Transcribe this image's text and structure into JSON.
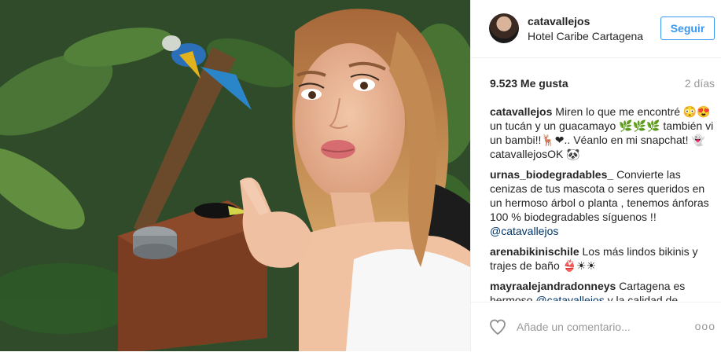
{
  "post": {
    "username": "catavallejos",
    "location": "Hotel Caribe Cartagena",
    "follow_label": "Seguir",
    "likes": "9.523 Me gusta",
    "time": "2 días",
    "comments": [
      {
        "user": "catavallejos",
        "text": "Miren lo que me encontré 😳😍 un tucán y un guacamayo 🌿🌿🌿 también vi un bambi!!🦌❤.. Véanlo en mi snapchat! 👻catavallejosOK 🐼",
        "mention": ""
      },
      {
        "user": "urnas_biodegradables_",
        "text": "Convierte las cenizas de tus mascota o seres queridos en un hermoso árbol o planta , tenemos ánforas 100 % biodegradables síguenos !! ",
        "mention": "@catavallejos"
      },
      {
        "user": "arenabikinischile",
        "text": "Los más lindos bikinis y trajes de baño 👙☀☀",
        "mention": ""
      },
      {
        "user": "mayraalejandradonneys",
        "text": "Cartagena es hermoso ",
        "mention": "@catavallejos",
        "tail": " y la calidad de"
      }
    ],
    "comment_placeholder": "Añade un comentario...",
    "more_label": "ooo"
  },
  "colors": {
    "accent": "#3897f0",
    "mention": "#003569",
    "muted": "#999999"
  },
  "icons": [
    "heart-icon",
    "more-options-icon"
  ]
}
